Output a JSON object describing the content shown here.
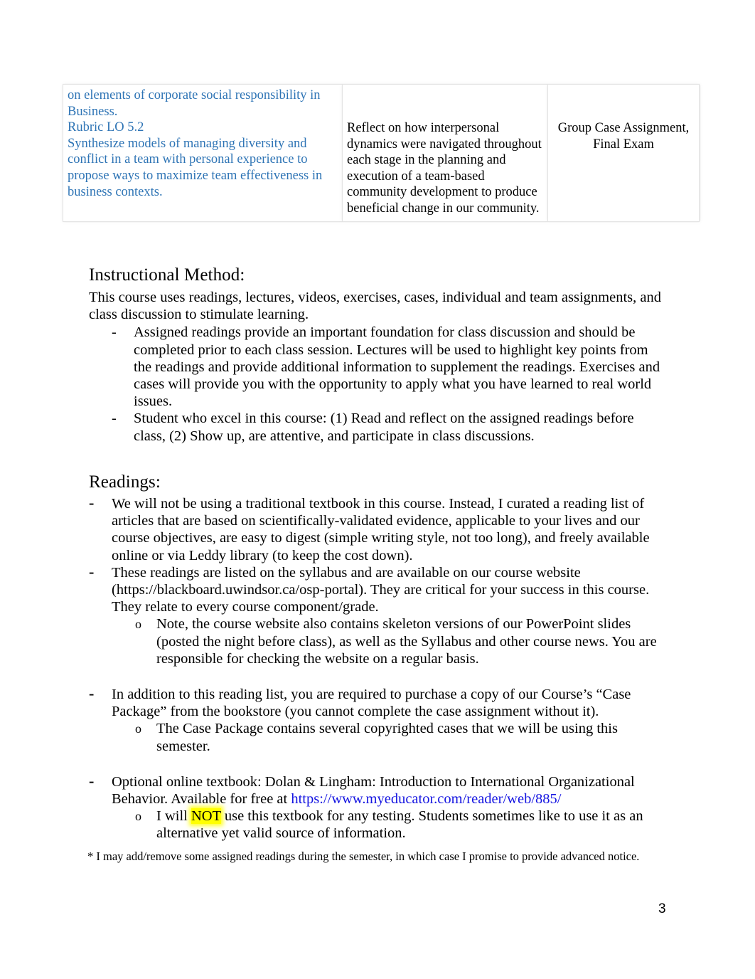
{
  "document": {
    "page_number": "3",
    "table": {
      "rows": [
        {
          "outcome_continued_blue": [
            "on elements of corporate social responsibility in Business.",
            "Rubric LO 5.2",
            "Synthesize models of managing diversity and conflict in a team with personal experience to propose ways to maximize team effectiveness in business contexts."
          ],
          "objective": "Reflect on how interpersonal dynamics were navigated throughout each stage in the planning and execution of a team-based community development to produce beneficial change in our community.",
          "assessment": "Group Case Assignment, Final Exam"
        }
      ]
    },
    "instructional_method": {
      "heading": "Instructional Method:",
      "intro": "This course uses readings, lectures, videos, exercises, cases, individual and team assignments, and class discussion to stimulate learning.",
      "bullets": [
        {
          "marker": "-",
          "text": "Assigned readings provide an important foundation for class discussion and should be completed prior to each class session. Lectures will be used to highlight key points from the readings and provide additional information to supplement the readings. Exercises and cases will provide you with the opportunity to apply what you have learned to real world issues."
        },
        {
          "marker": "-",
          "text": "Student who excel in this course: (1) Read and reflect on the assigned readings before class, (2) Show up, are attentive, and participate in class discussions."
        }
      ]
    },
    "readings": {
      "heading": "Readings:",
      "bullet_marker": "-",
      "sub_marker": "o",
      "item1": "We will not be using a traditional textbook in this course. Instead, I curated a reading list of articles that are based on scientifically-validated evidence, applicable to your lives and our course objectives, are easy to digest (simple writing style, not too long), and freely available online or via Leddy library (to keep the cost down).",
      "item2": "These readings are listed on the syllabus and are available on our course website (https://blackboard.uwindsor.ca/osp-portal). They are critical for your success in this course. They relate to every course component/grade.",
      "item2_sub1": "Note, the course website also contains skeleton versions of our PowerPoint slides (posted the night before class), as well as the Syllabus and other course news. You are responsible for checking the website on a regular basis.",
      "item3": "In addition to this reading list, you are required to purchase a copy of our Course’s “Case Package”  from the bookstore (you cannot complete the case assignment without it).",
      "item3_sub1": "The Case Package contains several copyrighted cases that we will be using this semester.",
      "item4_prefix": "Optional online textbook: Dolan & Lingham: Introduction to International Organizational Behavior. Available for free at ",
      "item4_link": "https://www.myeducator.com/reader/web/885/",
      "item4_sub1_before": "I will ",
      "item4_sub1_highlight": "NOT",
      "item4_sub1_after": " use this textbook for any testing. Students sometimes like to use it as an alternative yet valid source of information.",
      "footnote": "* I may add/remove some assigned readings during the semester, in which case I promise to provide advanced notice."
    },
    "colors": {
      "outcome_blue": "#2E74B5",
      "hyperlink_blue": "#1414E1",
      "highlight_yellow": "#FFFF00",
      "text_black": "#000000"
    }
  }
}
